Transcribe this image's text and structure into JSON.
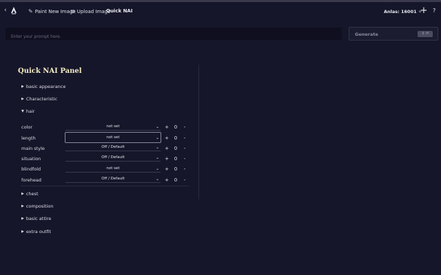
{
  "topbar": {
    "back_glyph": "‹",
    "paint_label": "Paint New Image",
    "paint_icon": "✎",
    "upload_label": "Upload Image",
    "upload_icon": "⧉",
    "title": "Quick NAI",
    "anlas": "Anlas: 16001 ✧",
    "plus_glyph": "+",
    "help_glyph": "?"
  },
  "prompt": {
    "placeholder": "Enter your prompt here.",
    "value": ""
  },
  "generate": {
    "label": "Generate",
    "badge": "⇧ ⏎"
  },
  "panel": {
    "title": "Quick NAI Panel",
    "sections_top": [
      {
        "label": "basic appearance",
        "expanded": false
      },
      {
        "label": "Characteristic",
        "expanded": false
      },
      {
        "label": "hair",
        "expanded": true
      }
    ],
    "rows": [
      {
        "label": "color",
        "value": "not set"
      },
      {
        "label": "length",
        "value": "not set"
      },
      {
        "label": "main style",
        "value": "Off / Default"
      },
      {
        "label": "situation",
        "value": "Off / Default"
      },
      {
        "label": "blindfold",
        "value": "not set"
      },
      {
        "label": "forehead",
        "value": "Off / Default"
      }
    ],
    "plus": "+",
    "count": "0",
    "minus": "-",
    "sections_bottom": [
      {
        "label": "chest"
      },
      {
        "label": "composition"
      },
      {
        "label": "basic attire"
      },
      {
        "label": "extra outfit"
      }
    ]
  },
  "icons": {
    "collapsed": "▶",
    "expanded": "▼",
    "chevron": "⌄"
  }
}
